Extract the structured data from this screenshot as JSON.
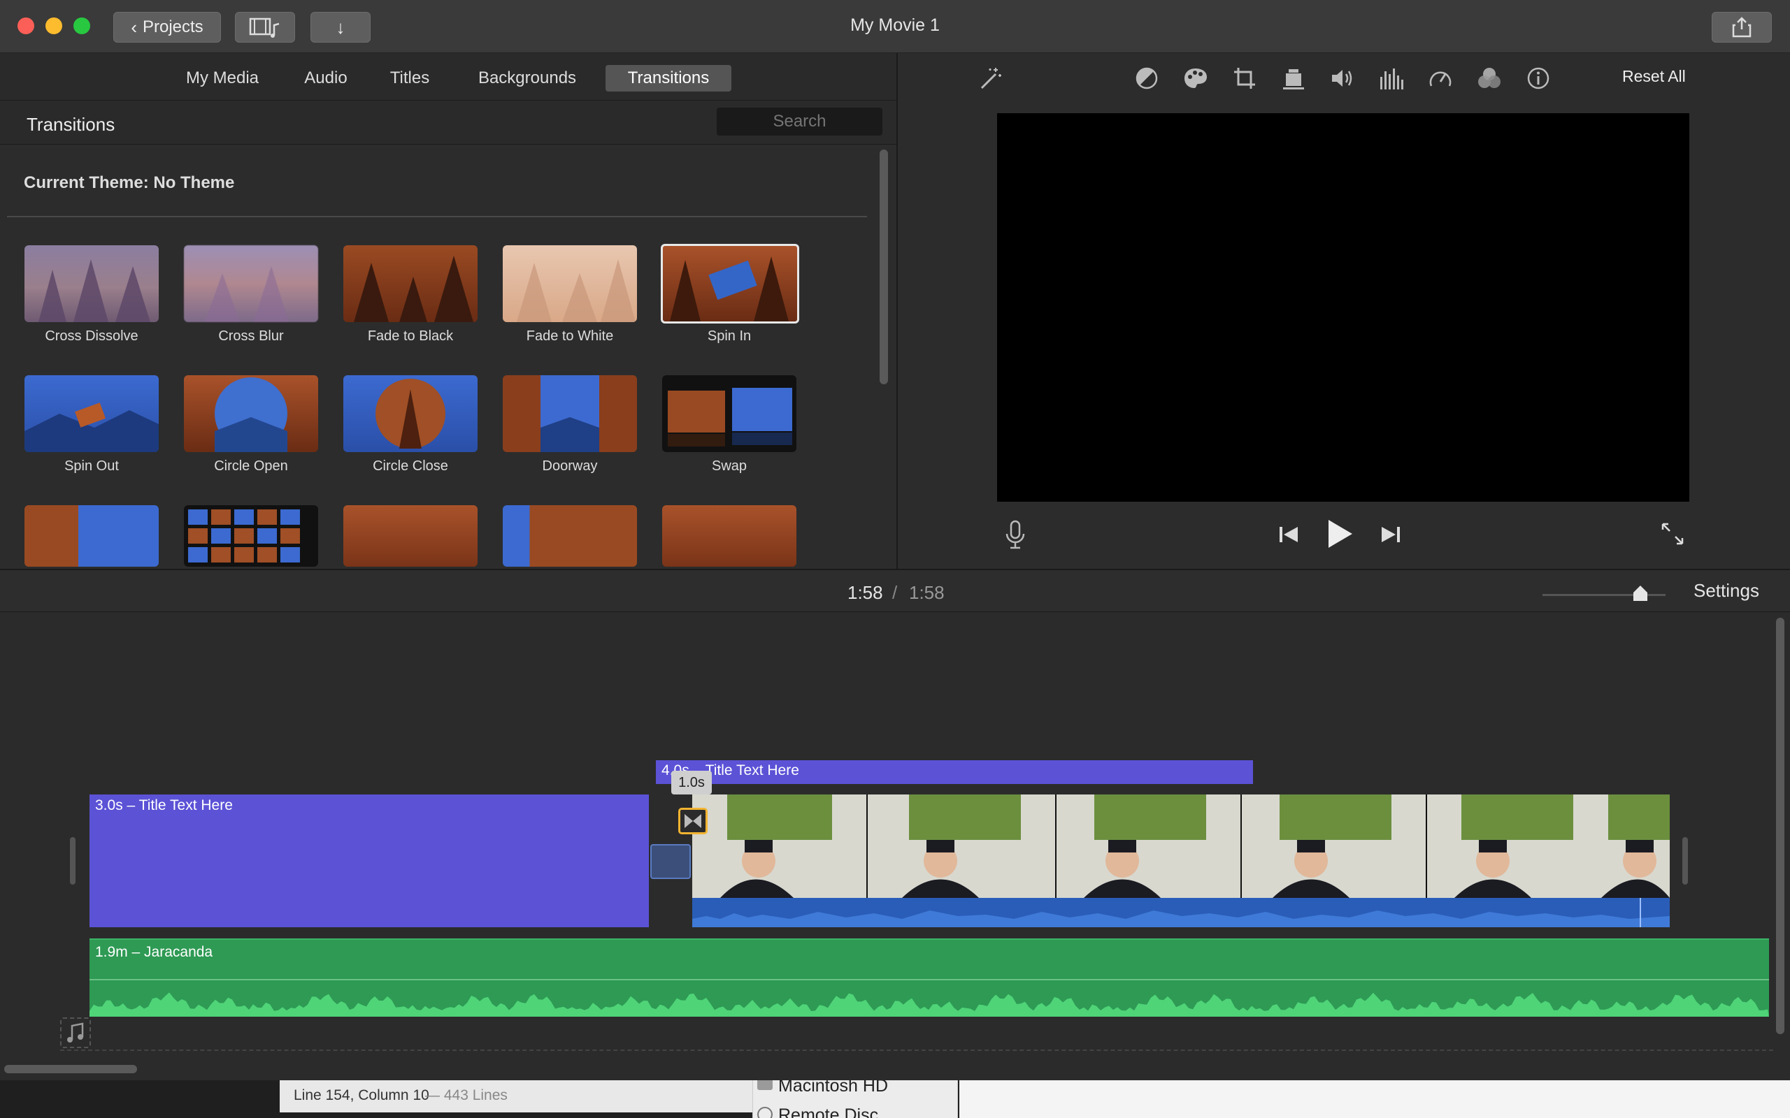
{
  "window": {
    "title": "My Movie 1",
    "projects_button": "Projects",
    "share_icon": "share-icon"
  },
  "browser": {
    "tabs": [
      "My Media",
      "Audio",
      "Titles",
      "Backgrounds",
      "Transitions"
    ],
    "active_tab": "Transitions",
    "section_title": "Transitions",
    "search_placeholder": "Search",
    "theme_text": "Current Theme: No Theme",
    "transitions": [
      {
        "label": "Cross Dissolve"
      },
      {
        "label": "Cross Blur"
      },
      {
        "label": "Fade to Black"
      },
      {
        "label": "Fade to White"
      },
      {
        "label": "Spin In"
      },
      {
        "label": "Spin Out"
      },
      {
        "label": "Circle Open"
      },
      {
        "label": "Circle Close"
      },
      {
        "label": "Doorway"
      },
      {
        "label": "Swap"
      }
    ],
    "selected": "Spin In"
  },
  "viewer": {
    "reset_all": "Reset All"
  },
  "timeline": {
    "current_time": "1:58",
    "separator": "/",
    "total_time": "1:58",
    "settings": "Settings",
    "title_clip_1": "3.0s – Title Text Here",
    "title_clip_2": "4.0s – Title Text Here",
    "transition_duration": "1.0s",
    "audio_clip": "1.9m – Jaracanda"
  },
  "background_windows": {
    "status_line": "Line 154, Column 10",
    "line_count": "— 443 Lines",
    "sidebar_item_1": "Macintosh HD",
    "sidebar_item_2": "Remote Disc"
  },
  "colors": {
    "title_clip": "#5b52d6",
    "audio_clip": "#2e9a54",
    "video_audio": "#2a5db8",
    "transition_marker": "#f2b431"
  }
}
